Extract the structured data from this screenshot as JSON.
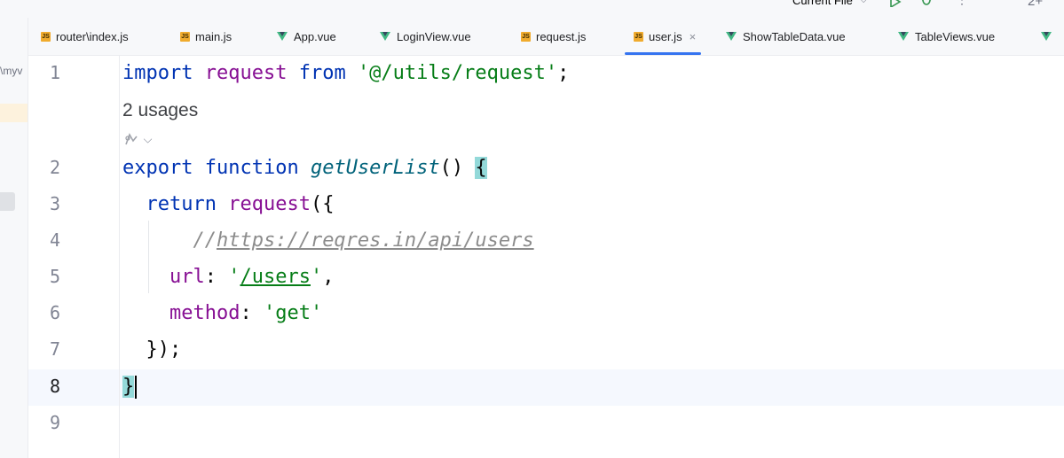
{
  "toolbar": {
    "run_config": "Current File",
    "run_config_chevron": "⌵",
    "badge": "2+",
    "icons": [
      "run-icon",
      "debug-icon",
      "more-vert-icon"
    ]
  },
  "project_panel": {
    "path_fragment": "\\myv"
  },
  "tabs": [
    {
      "label": "router\\index.js",
      "type": "js"
    },
    {
      "label": "main.js",
      "type": "js"
    },
    {
      "label": "App.vue",
      "type": "vue"
    },
    {
      "label": "LoginView.vue",
      "type": "vue"
    },
    {
      "label": "request.js",
      "type": "js"
    },
    {
      "label": "user.js",
      "type": "js",
      "active": true,
      "close": "×"
    },
    {
      "label": "ShowTableData.vue",
      "type": "vue"
    },
    {
      "label": "TableViews.vue",
      "type": "vue"
    }
  ],
  "editor": {
    "line_numbers": [
      "1",
      "2",
      "3",
      "4",
      "5",
      "6",
      "7",
      "8",
      "9"
    ],
    "current_line": "8",
    "usages": "2 usages",
    "inlay_chevron": "⌵",
    "code": {
      "l1": {
        "kw1": "import",
        "id": "request",
        "kw2": "from",
        "str": "'@/utils/request'",
        "end": ";"
      },
      "l2": {
        "kw": "export",
        "kw2": "function",
        "fn": "getUserList",
        "paren": "() ",
        "brace": "{"
      },
      "l3": {
        "kw": "return",
        "call": "request",
        "open": "({"
      },
      "l4": {
        "cmt_prefix": "//",
        "url": "https://reqres.in/api/users"
      },
      "l5": {
        "key": "url",
        "colon": ": ",
        "q1": "'",
        "path": "/users",
        "q2": "'",
        "comma": ","
      },
      "l6": {
        "key": "method",
        "colon": ": ",
        "str": "'get'"
      },
      "l7": {
        "close": "});"
      },
      "l8": {
        "brace": "}"
      }
    }
  },
  "colors": {
    "keyword": "#0033b3",
    "identifier": "#871094",
    "string": "#067d17",
    "function": "#00627a",
    "comment": "#8c8c8c",
    "active_tab_underline": "#3574f0",
    "brace_match": "#93d9d9"
  }
}
